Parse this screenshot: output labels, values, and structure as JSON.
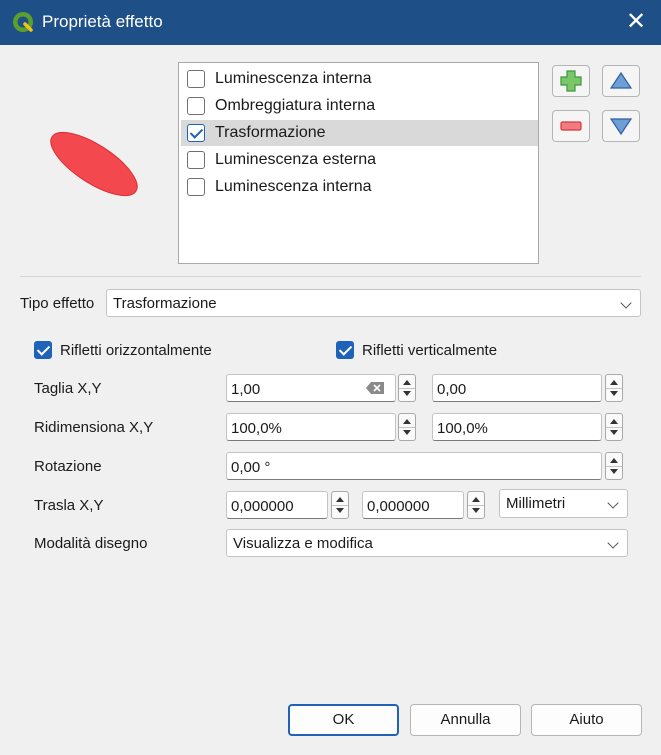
{
  "window": {
    "title": "Proprietà effetto",
    "close_glyph": "✕"
  },
  "effects": [
    {
      "label": "Luminescenza interna",
      "checked": false,
      "selected": false
    },
    {
      "label": "Ombreggiatura interna",
      "checked": false,
      "selected": false
    },
    {
      "label": "Trasformazione",
      "checked": true,
      "selected": true
    },
    {
      "label": "Luminescenza esterna",
      "checked": false,
      "selected": false
    },
    {
      "label": "Luminescenza interna",
      "checked": false,
      "selected": false
    }
  ],
  "toolbar_icons": [
    "add-icon",
    "remove-icon",
    "move-up-icon",
    "move-down-icon"
  ],
  "form": {
    "effect_type_label": "Tipo effetto",
    "effect_type_value": "Trasformazione",
    "flip_h_label": "Rifletti orizzontalmente",
    "flip_v_label": "Rifletti verticalmente",
    "shear_label": "Taglia X,Y",
    "shear_x": "1,00",
    "shear_y": "0,00",
    "scale_label": "Ridimensiona X,Y",
    "scale_x": "100,0%",
    "scale_y": "100,0%",
    "rotation_label": "Rotazione",
    "rotation_value": "0,00 °",
    "translate_label": "Trasla X,Y",
    "translate_x": "0,000000",
    "translate_y": "0,000000",
    "unit_value": "Millimetri",
    "draw_mode_label": "Modalità disegno",
    "draw_mode_value": "Visualizza e modifica"
  },
  "buttons": {
    "ok": "OK",
    "cancel": "Annulla",
    "help": "Aiuto"
  },
  "colors": {
    "titlebar": "#1e4f87",
    "accent": "#1e63b8",
    "preview_fill": "#f2484e",
    "add_green": "#3b9a3b",
    "remove_red": "#d4373f",
    "arrow_blue": "#3e78c2"
  }
}
